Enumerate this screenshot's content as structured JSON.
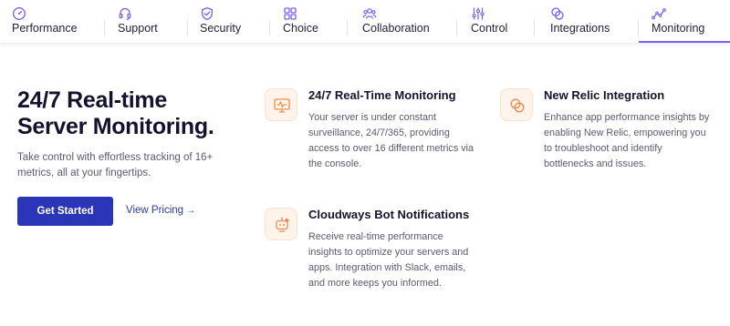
{
  "tabs": [
    {
      "label": "Performance",
      "icon": "gauge-icon"
    },
    {
      "label": "Support",
      "icon": "headset-icon"
    },
    {
      "label": "Security",
      "icon": "shield-icon"
    },
    {
      "label": "Choice",
      "icon": "grid-icon"
    },
    {
      "label": "Collaboration",
      "icon": "team-icon"
    },
    {
      "label": "Control",
      "icon": "sliders-icon"
    },
    {
      "label": "Integrations",
      "icon": "link-icon"
    },
    {
      "label": "Monitoring",
      "icon": "graph-icon",
      "active": true
    }
  ],
  "hero": {
    "title_line1": "24/7 Real-time",
    "title_line2": "Server Monitoring.",
    "subtitle": "Take control with effortless tracking of 16+ metrics, all at your fingertips.",
    "cta_label": "Get Started",
    "link_label": "View Pricing",
    "link_arrow": "→"
  },
  "features": [
    {
      "title": "24/7 Real-Time Monitoring",
      "description": "Your server is under constant surveillance, 24/7/365, providing access to over 16 different metrics via the console.",
      "icon": "monitor-icon"
    },
    {
      "title": "New Relic Integration",
      "description": "Enhance app performance insights by enabling New Relic, empowering you to troubleshoot and identify bottlenecks and issues.",
      "icon": "new-relic-icon"
    },
    {
      "title": "Cloudways Bot Notifications",
      "description": "Receive real-time performance insights to optimize your servers and apps. Integration with Slack, emails, and more keeps you informed.",
      "icon": "bot-icon"
    }
  ],
  "colors": {
    "accent": "#7c5cf3",
    "primary_button": "#2b35b8",
    "icon_orange": "#f08a4b",
    "icon_bg": "#fff4ec"
  }
}
